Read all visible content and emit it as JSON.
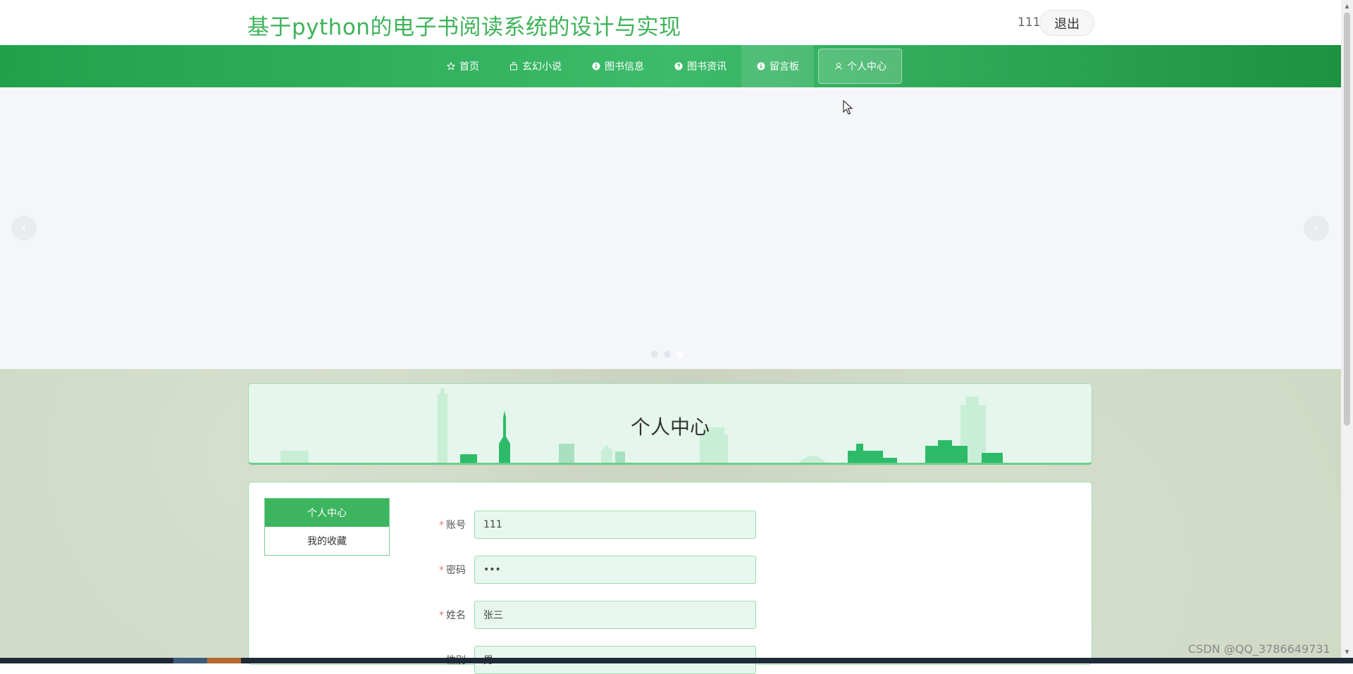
{
  "header": {
    "site_title": "基于python的电子书阅读系统的设计与实现",
    "username": "111",
    "logout_label": "退出"
  },
  "nav": {
    "items": [
      {
        "label": "首页",
        "icon": "star-icon"
      },
      {
        "label": "玄幻小说",
        "icon": "bag-icon"
      },
      {
        "label": "图书信息",
        "icon": "info-icon"
      },
      {
        "label": "图书资讯",
        "icon": "question-icon"
      },
      {
        "label": "留言板",
        "icon": "info-icon"
      },
      {
        "label": "个人中心",
        "icon": "user-icon"
      }
    ],
    "hovered": "留言板",
    "active": "个人中心"
  },
  "carousel": {
    "prev_icon": "chevron-left-icon",
    "next_icon": "chevron-right-icon",
    "slide_count": 3,
    "active_slide": 3
  },
  "banner": {
    "title": "个人中心"
  },
  "side_menu": {
    "items": [
      "个人中心",
      "我的收藏"
    ],
    "active": "个人中心"
  },
  "form": {
    "fields": [
      {
        "label": "账号",
        "required": true,
        "value": "111"
      },
      {
        "label": "密码",
        "required": true,
        "value": "•••"
      },
      {
        "label": "姓名",
        "required": true,
        "value": "张三"
      },
      {
        "label": "性别",
        "required": false,
        "value": "男"
      }
    ]
  },
  "watermark": "CSDN @QQ_3786649731",
  "colors": {
    "brand_green": "#3fb35a",
    "nav_green": "#22a04a",
    "required_red": "#f56c6c"
  }
}
